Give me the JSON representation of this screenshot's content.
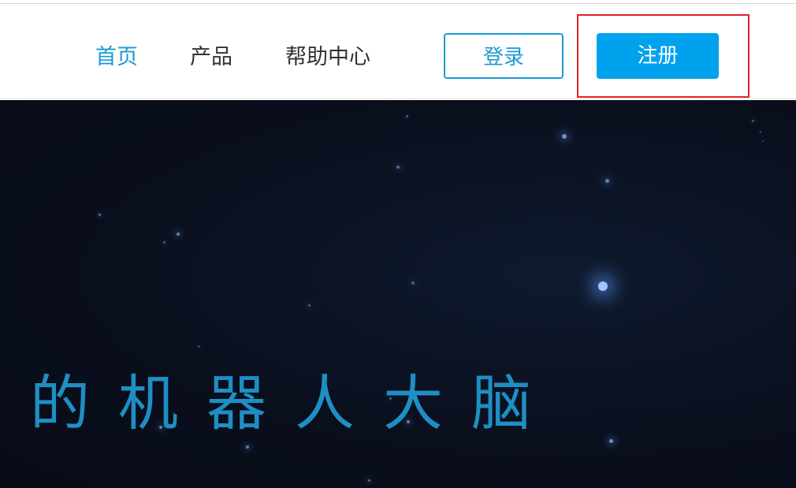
{
  "nav": {
    "items": [
      {
        "label": "首页",
        "active": true
      },
      {
        "label": "产品",
        "active": false
      },
      {
        "label": "帮助中心",
        "active": false
      }
    ],
    "login_label": "登录",
    "register_label": "注册"
  },
  "hero": {
    "title": "的机器人大脑"
  },
  "colors": {
    "accent": "#00a2ee",
    "active_nav": "#1a9ad6",
    "highlight": "#e0202a",
    "hero_bg": "#0a0f1d"
  }
}
